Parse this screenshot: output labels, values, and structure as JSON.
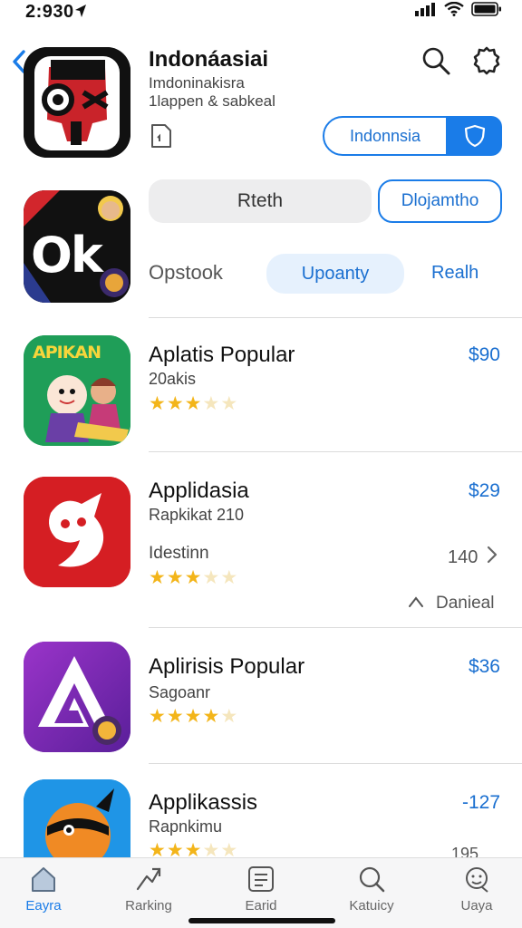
{
  "status": {
    "time": "2:930"
  },
  "header": {
    "title": "Indonáasiai",
    "subtitle1": "Imdoninakisra",
    "subtitle2": "1lappen & sabkeal",
    "region_label": "Indonnsia"
  },
  "filters": {
    "pill_left": "Rteth",
    "pill_right": "Dlojamtho",
    "label": "Opstook",
    "chip_selected": "Upoanty",
    "chip_link": "Realh"
  },
  "apps": [
    {
      "title": "Aplatis Popular",
      "subtitle": "20akis",
      "price": "$90",
      "rating": 3
    },
    {
      "title": "Applidasia",
      "subtitle": "Rapkikat 210",
      "extra": "Idestinn",
      "count": "140",
      "expand_label": "Danieal",
      "price": "$29",
      "rating": 3
    },
    {
      "title": "Aplirisis Popular",
      "subtitle": "Sagoanr",
      "price": "$36",
      "rating": 4
    },
    {
      "title": "Applikassis",
      "subtitle": "Rapnkimu",
      "count": "195",
      "price": "-127",
      "rating": 3
    }
  ],
  "icon_texts": {
    "featured_text": "Ok",
    "row1_text": "APIKAN"
  },
  "tabbar": {
    "tabs": [
      {
        "label": "Eayra",
        "icon": "home-icon"
      },
      {
        "label": "Rarking",
        "icon": "ranking-icon"
      },
      {
        "label": "Earid",
        "icon": "list-icon"
      },
      {
        "label": "Katuicy",
        "icon": "search-icon"
      },
      {
        "label": "Uaya",
        "icon": "profile-icon"
      }
    ]
  },
  "colors": {
    "accent": "#1a7ce8",
    "star": "#f3b51a"
  }
}
